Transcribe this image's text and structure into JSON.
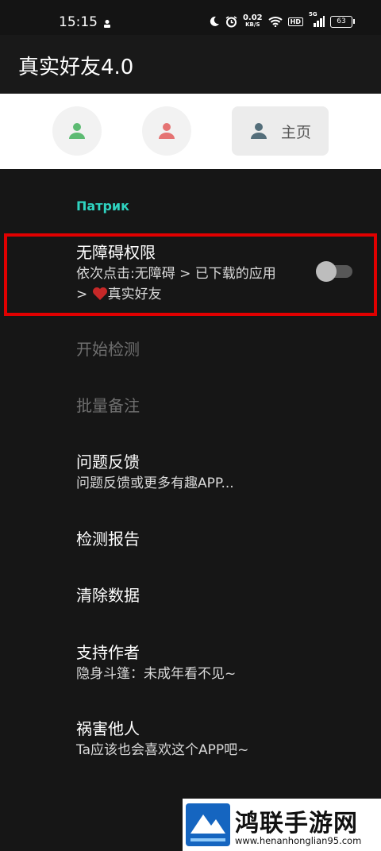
{
  "status": {
    "time": "15:15",
    "speed_value": "0.02",
    "speed_unit": "KB/S",
    "hd": "HD",
    "network": "5G",
    "battery": "63"
  },
  "app": {
    "title": "真实好友4.0"
  },
  "tabs": {
    "home_label": "主页",
    "person1_color": "#5dbb73",
    "person2_color": "#e57373",
    "home_icon_color": "#546e7a"
  },
  "section": {
    "header": "Патрик"
  },
  "items": {
    "accessibility_title": "无障碍权限",
    "accessibility_sub_line1": "依次点击:无障碍 > 已下载的应用",
    "accessibility_sub_line2_prefix": ">",
    "accessibility_sub_line2_suffix": "真实好友",
    "accessibility_enabled": false,
    "start_detect": "开始检测",
    "batch_remark": "批量备注",
    "feedback_title": "问题反馈",
    "feedback_sub": "问题反馈或更多有趣APP...",
    "report": "检测报告",
    "clear_data": "清除数据",
    "support_title": "支持作者",
    "support_sub": "隐身斗篷：未成年看不见~",
    "harm_title": "祸害他人",
    "harm_sub": "Ta应该也会喜欢这个APP吧~"
  },
  "watermark": {
    "title": "鸿联手游网",
    "url": "www.henanhonglian95.com"
  },
  "colors": {
    "accent": "#2fd3c0",
    "highlight": "#e00000",
    "background": "#161616"
  }
}
